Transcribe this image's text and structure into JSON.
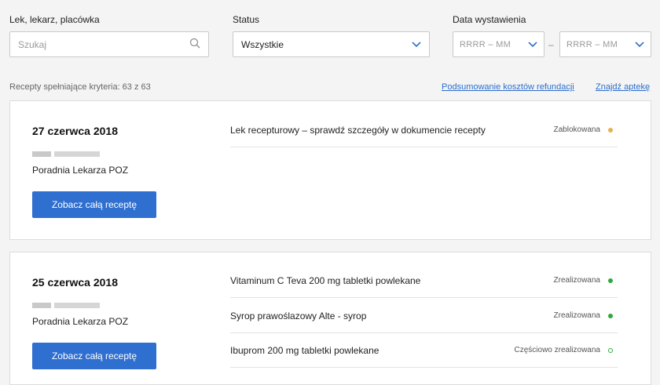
{
  "filters": {
    "search_label": "Lek, lekarz, placówka",
    "search_placeholder": "Szukaj",
    "status_label": "Status",
    "status_value": "Wszystkie",
    "date_label": "Data wystawienia",
    "date_from_year": "RRRR",
    "date_from_month": "MM",
    "date_sep": "–",
    "date_to_year": "RRRR",
    "date_to_month": "MM"
  },
  "summary": {
    "count_text": "Recepty spełniające kryteria: 63 z 63",
    "refund_link": "Podsumowanie kosztów refundacji",
    "pharmacy_link": "Znajdź aptekę"
  },
  "prescriptions": [
    {
      "date": "27 czerwca 2018",
      "facility": "Poradnia Lekarza POZ",
      "button": "Zobacz całą receptę",
      "items": [
        {
          "name": "Lek recepturowy – sprawdź szczegóły w dokumencie recepty",
          "status": "Zablokowana",
          "status_color": "#e8b04e"
        }
      ]
    },
    {
      "date": "25 czerwca 2018",
      "facility": "Poradnia Lekarza POZ",
      "button": "Zobacz całą receptę",
      "items": [
        {
          "name": "Vitaminum C Teva 200 mg tabletki powlekane",
          "status": "Zrealizowana",
          "status_color": "#2ea83c"
        },
        {
          "name": "Syrop prawoślazowy Alte - syrop",
          "status": "Zrealizowana",
          "status_color": "#2ea83c"
        },
        {
          "name": "Ibuprom 200 mg tabletki powlekane",
          "status": "Częściowo zrealizowana",
          "status_color": "#2ea83c"
        }
      ]
    }
  ],
  "colors": {
    "accent": "#2f6fd0",
    "link": "#2a6ecf"
  }
}
